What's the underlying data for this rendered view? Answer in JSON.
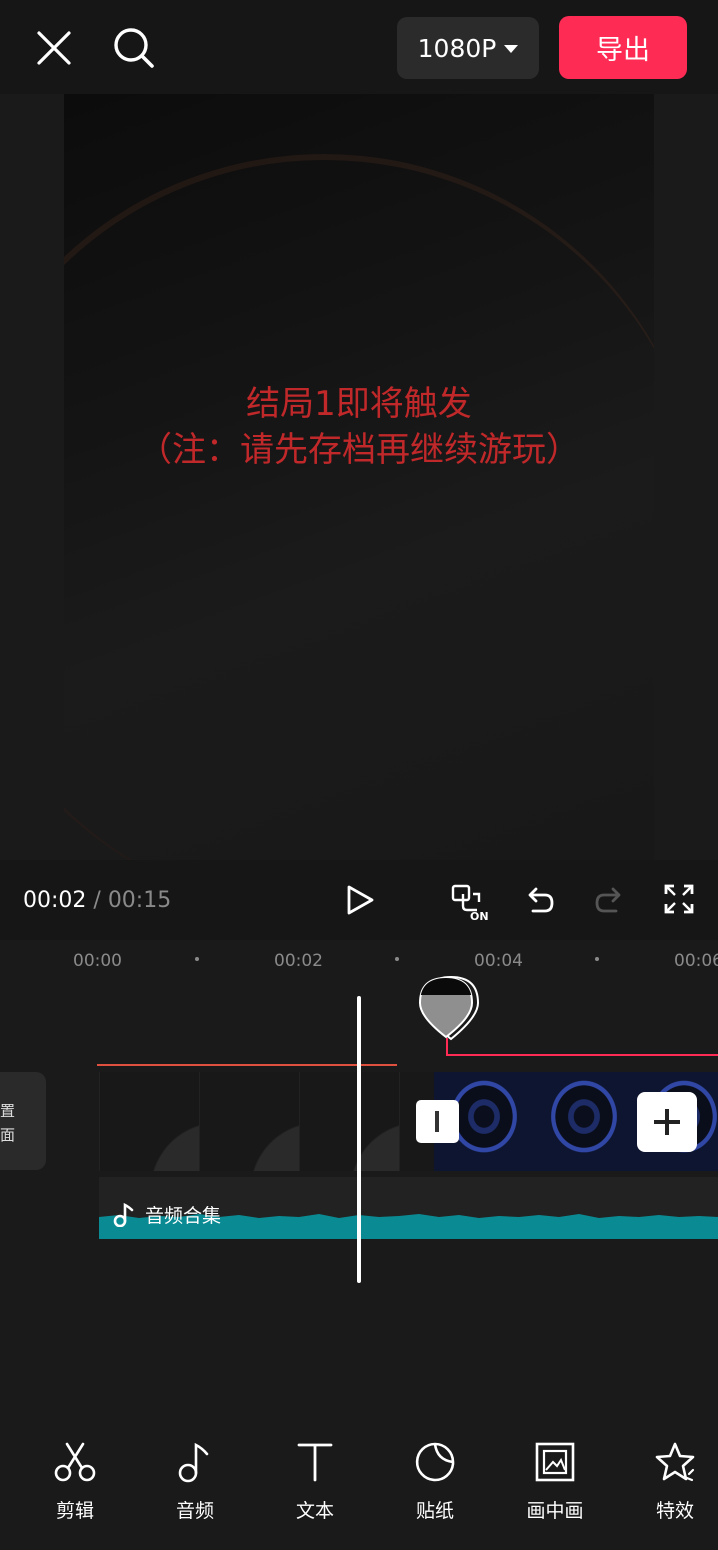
{
  "topbar": {
    "close_icon": "close-icon",
    "search_icon": "search-icon",
    "resolution": "1080P",
    "export_label": "导出"
  },
  "preview": {
    "line1": "结局1即将触发",
    "line2": "（注：请先存档再继续游玩）"
  },
  "playback": {
    "current": "00:02",
    "separator": " / ",
    "total": "00:15"
  },
  "timeline": {
    "ticks": [
      "00:00",
      "00:02",
      "00:04",
      "00:06"
    ],
    "cover_label_line1": "置",
    "cover_label_line2": "面",
    "audio_label": "音频合集"
  },
  "toolbar": {
    "items": [
      {
        "label": "剪辑",
        "icon": "scissors-icon"
      },
      {
        "label": "音频",
        "icon": "music-note-icon"
      },
      {
        "label": "文本",
        "icon": "text-icon"
      },
      {
        "label": "贴纸",
        "icon": "sticker-icon"
      },
      {
        "label": "画中画",
        "icon": "picture-in-picture-icon"
      },
      {
        "label": "特效",
        "icon": "effects-star-icon"
      }
    ]
  },
  "colors": {
    "accent": "#fe2c55",
    "audio_wave": "#0a8b94",
    "preview_text": "#c0282a"
  }
}
